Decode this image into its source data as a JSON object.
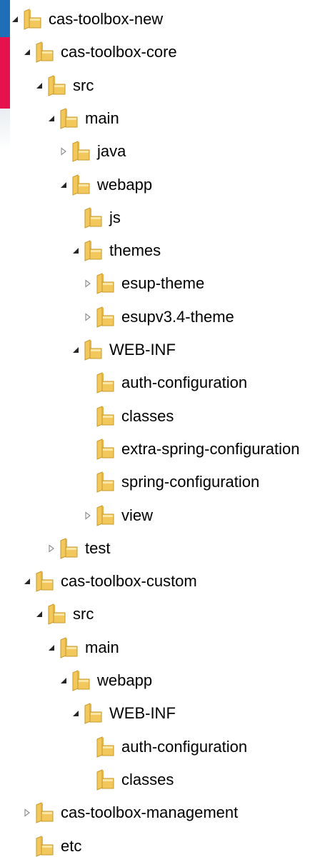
{
  "theme": {
    "text_color": "#000000",
    "folder_color": "#f2c75c",
    "expand_arrow_color": "#262626",
    "collapse_arrow_color": "#8a8a8a"
  },
  "tree": [
    {
      "label": "cas-toolbox-new",
      "depth": 0,
      "state": "expanded"
    },
    {
      "label": "cas-toolbox-core",
      "depth": 1,
      "state": "expanded"
    },
    {
      "label": "src",
      "depth": 2,
      "state": "expanded"
    },
    {
      "label": "main",
      "depth": 3,
      "state": "expanded"
    },
    {
      "label": "java",
      "depth": 4,
      "state": "collapsed"
    },
    {
      "label": "webapp",
      "depth": 4,
      "state": "expanded"
    },
    {
      "label": "js",
      "depth": 5,
      "state": "leaf"
    },
    {
      "label": "themes",
      "depth": 5,
      "state": "expanded"
    },
    {
      "label": "esup-theme",
      "depth": 6,
      "state": "collapsed"
    },
    {
      "label": "esupv3.4-theme",
      "depth": 6,
      "state": "collapsed"
    },
    {
      "label": "WEB-INF",
      "depth": 5,
      "state": "expanded"
    },
    {
      "label": "auth-configuration",
      "depth": 6,
      "state": "leaf"
    },
    {
      "label": "classes",
      "depth": 6,
      "state": "leaf"
    },
    {
      "label": "extra-spring-configuration",
      "depth": 6,
      "state": "leaf"
    },
    {
      "label": "spring-configuration",
      "depth": 6,
      "state": "leaf"
    },
    {
      "label": "view",
      "depth": 6,
      "state": "collapsed"
    },
    {
      "label": "test",
      "depth": 3,
      "state": "collapsed"
    },
    {
      "label": "cas-toolbox-custom",
      "depth": 1,
      "state": "expanded"
    },
    {
      "label": "src",
      "depth": 2,
      "state": "expanded"
    },
    {
      "label": "main",
      "depth": 3,
      "state": "expanded"
    },
    {
      "label": "webapp",
      "depth": 4,
      "state": "expanded"
    },
    {
      "label": "WEB-INF",
      "depth": 5,
      "state": "expanded"
    },
    {
      "label": "auth-configuration",
      "depth": 6,
      "state": "leaf"
    },
    {
      "label": "classes",
      "depth": 6,
      "state": "leaf"
    },
    {
      "label": "cas-toolbox-management",
      "depth": 1,
      "state": "collapsed"
    },
    {
      "label": "etc",
      "depth": 1,
      "state": "leaf"
    }
  ]
}
